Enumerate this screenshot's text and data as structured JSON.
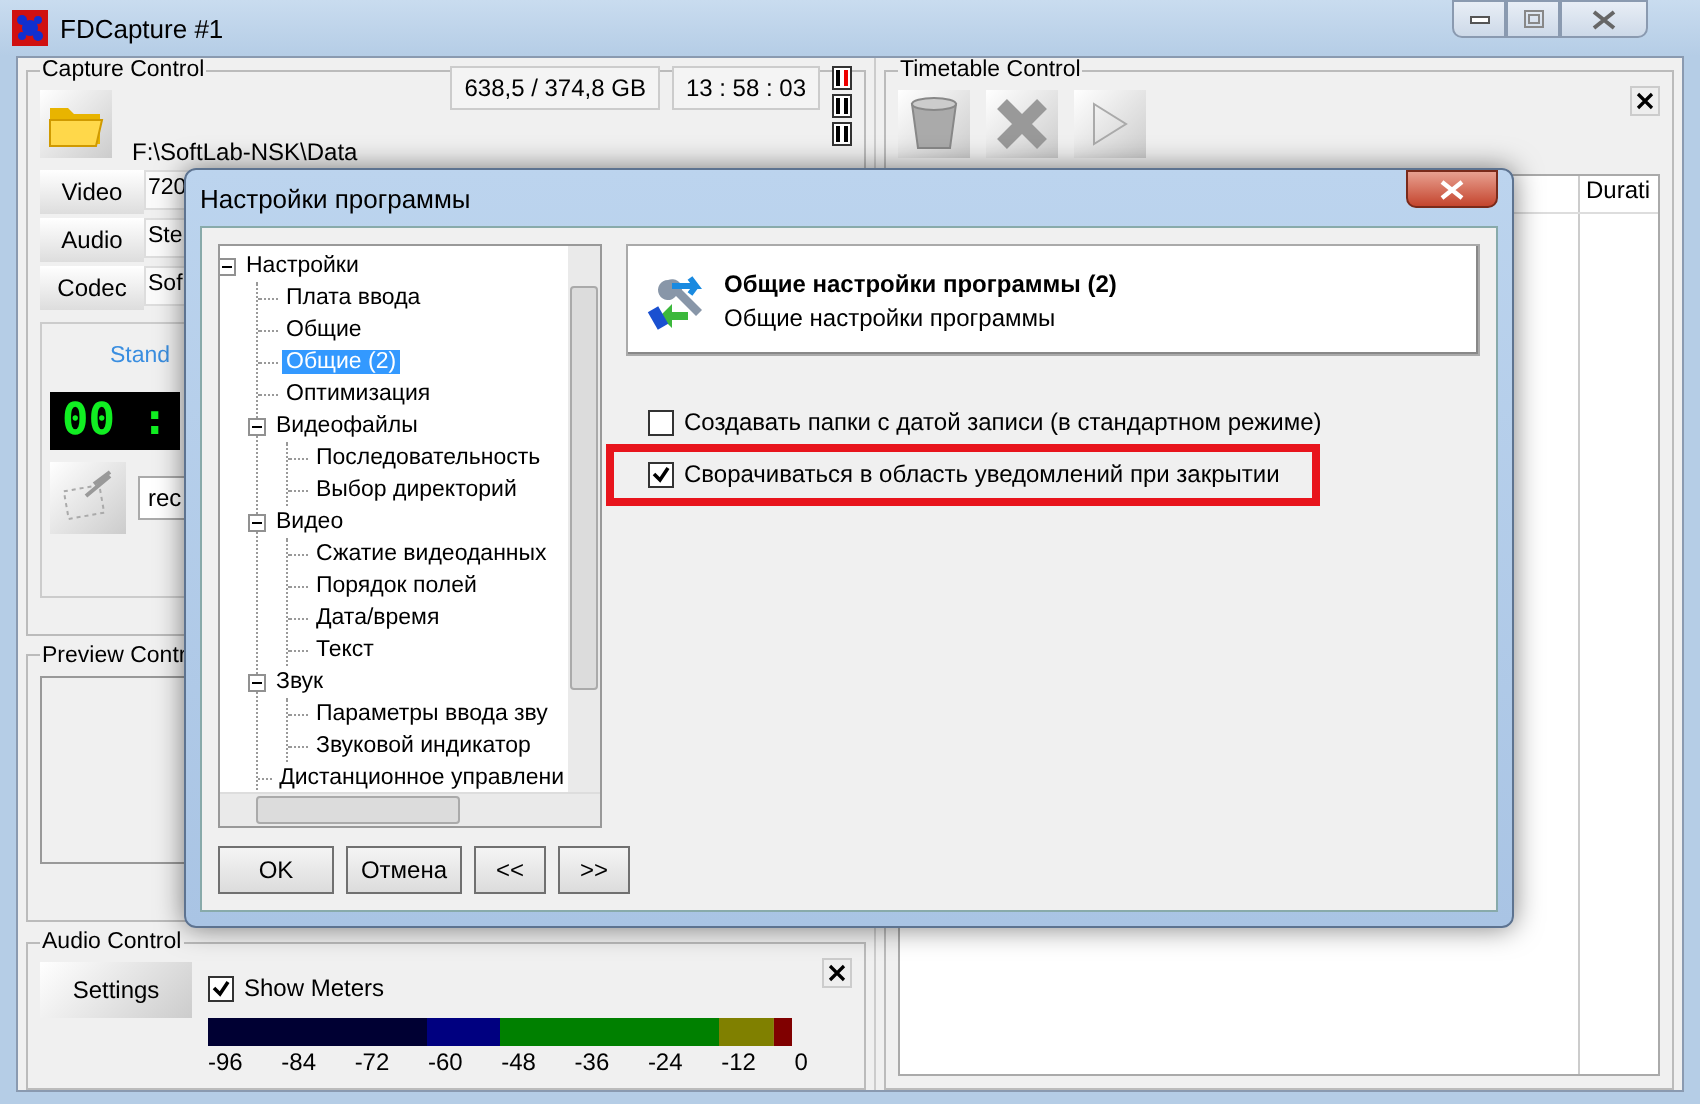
{
  "window": {
    "title": "FDCapture #1"
  },
  "capture_control": {
    "title": "Capture Control",
    "path": "F:\\SoftLab-NSK\\Data",
    "disk_space": "638,5 / 374,8 GB",
    "time": "13 : 58 : 03",
    "sources": [
      {
        "label": "Video",
        "value": "720"
      },
      {
        "label": "Audio",
        "value": "Ste"
      },
      {
        "label": "Codec",
        "value": "Sof"
      }
    ],
    "mode_tab": "Stand",
    "counter": "00 :",
    "file_name": "rec"
  },
  "preview_control": {
    "title": "Preview Contr"
  },
  "audio_control": {
    "title": "Audio Control",
    "settings_button": "Settings",
    "show_meters": {
      "label": "Show Meters",
      "checked": true
    },
    "scale": [
      "-96",
      "-84",
      "-72",
      "-60",
      "-48",
      "-36",
      "-24",
      "-12",
      "0"
    ]
  },
  "timetable_control": {
    "title": "Timetable Control",
    "columns": [
      "Durati"
    ]
  },
  "dialog": {
    "title": "Настройки программы",
    "tree": [
      {
        "label": "Настройки",
        "selected": false,
        "expanded": true,
        "children": [
          {
            "label": "Плата ввода",
            "selected": false
          },
          {
            "label": "Общие",
            "selected": false
          },
          {
            "label": "Общие (2)",
            "selected": true
          },
          {
            "label": "Оптимизация",
            "selected": false
          },
          {
            "label": "Видеофайлы",
            "selected": false,
            "expanded": true,
            "children": [
              {
                "label": "Последовательность",
                "selected": false
              },
              {
                "label": "Выбор директорий",
                "selected": false
              }
            ]
          },
          {
            "label": "Видео",
            "selected": false,
            "expanded": true,
            "children": [
              {
                "label": "Сжатие видеоданных",
                "selected": false
              },
              {
                "label": "Порядок полей",
                "selected": false
              },
              {
                "label": "Дата/время",
                "selected": false
              },
              {
                "label": "Текст",
                "selected": false
              }
            ]
          },
          {
            "label": "Звук",
            "selected": false,
            "expanded": true,
            "children": [
              {
                "label": "Параметры ввода зву",
                "selected": false
              },
              {
                "label": "Звуковой индикатор",
                "selected": false
              }
            ]
          },
          {
            "label": "Дистанционное управлени",
            "selected": false
          }
        ]
      }
    ],
    "header": {
      "title": "Общие настройки программы (2)",
      "subtitle": "Общие настройки программы"
    },
    "options": [
      {
        "label": "Создавать папки с датой записи (в стандартном режиме)",
        "checked": false,
        "highlighted": false
      },
      {
        "label": "Сворачиваться в область уведомлений при закрытии",
        "checked": true,
        "highlighted": true
      }
    ],
    "buttons": [
      "OK",
      "Отмена",
      "<<",
      ">>"
    ]
  }
}
